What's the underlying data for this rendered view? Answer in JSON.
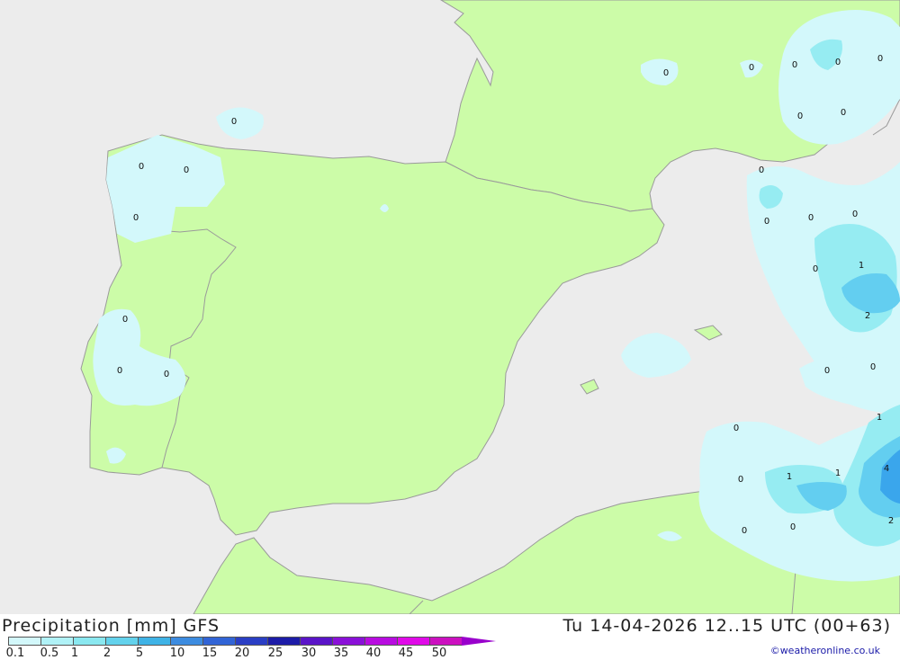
{
  "title": "Precipitation [mm] GFS",
  "datetime": "Tu 14-04-2026 12..15 UTC (00+63)",
  "credit": "©weatheronline.co.uk",
  "colors": {
    "sea": "#ececec",
    "land": "#ccfca8",
    "border": "#9a9a9a",
    "precip_light": "#d3f8fb",
    "precip_medium": "#96ecf2",
    "precip_heavy": "#63cef0",
    "precip_heavier": "#3aa6ec"
  },
  "legend": {
    "labels": [
      "0.1",
      "0.5",
      "1",
      "2",
      "5",
      "10",
      "15",
      "20",
      "25",
      "30",
      "35",
      "40",
      "45",
      "50"
    ],
    "colors": [
      "#d3f8fb",
      "#b0f2f7",
      "#8ae8f0",
      "#63d2ec",
      "#3fb3e6",
      "#3d8ce0",
      "#3164d6",
      "#2a3ec4",
      "#1d1ca8",
      "#5a14c8",
      "#8a10d8",
      "#b80ce0",
      "#e00ae8",
      "#cc10c0"
    ]
  },
  "contour_labels": [
    {
      "text": "0"
    },
    {
      "text": "0"
    },
    {
      "text": "0"
    },
    {
      "text": "0"
    },
    {
      "text": "0"
    },
    {
      "text": "0"
    },
    {
      "text": "0"
    },
    {
      "text": "0"
    },
    {
      "text": "0"
    },
    {
      "text": "0"
    },
    {
      "text": "0"
    },
    {
      "text": "0"
    },
    {
      "text": "0"
    },
    {
      "text": "0"
    },
    {
      "text": "0"
    },
    {
      "text": "0"
    },
    {
      "text": "0"
    },
    {
      "text": "1"
    },
    {
      "text": "2"
    },
    {
      "text": "0"
    },
    {
      "text": "0"
    },
    {
      "text": "1"
    },
    {
      "text": "0"
    },
    {
      "text": "0"
    },
    {
      "text": "1"
    },
    {
      "text": "1"
    },
    {
      "text": "4"
    },
    {
      "text": "0"
    },
    {
      "text": "0"
    },
    {
      "text": "0"
    },
    {
      "text": "2"
    },
    {
      "text": "0"
    }
  ]
}
